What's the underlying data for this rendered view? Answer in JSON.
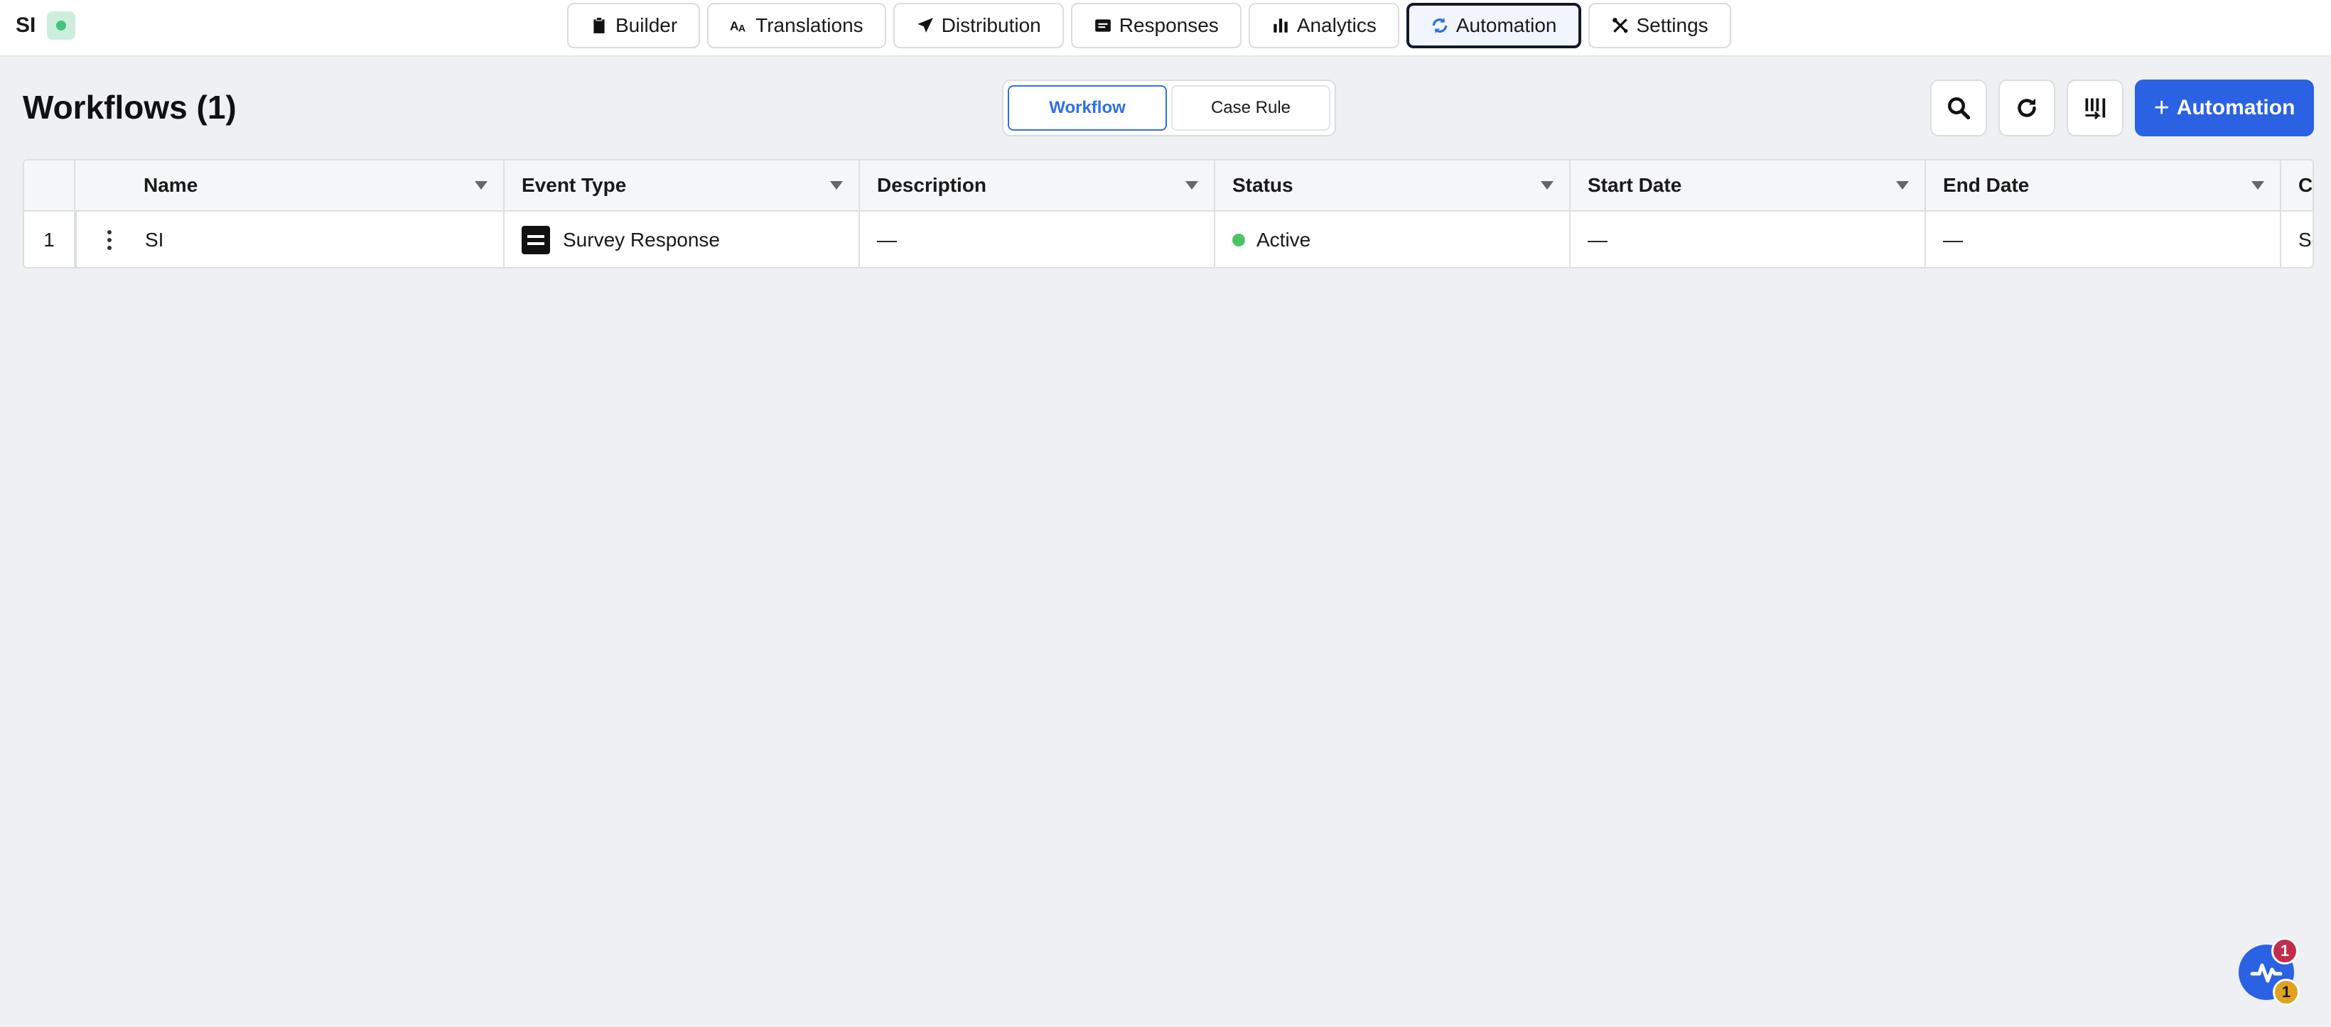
{
  "app": {
    "name": "SI",
    "status_color": "#45c27c"
  },
  "nav": {
    "tabs": [
      {
        "label": "Builder",
        "icon": "clipboard-icon"
      },
      {
        "label": "Translations",
        "icon": "translate-icon"
      },
      {
        "label": "Distribution",
        "icon": "send-icon"
      },
      {
        "label": "Responses",
        "icon": "message-icon"
      },
      {
        "label": "Analytics",
        "icon": "bar-chart-icon"
      },
      {
        "label": "Automation",
        "icon": "sync-icon",
        "active": true
      },
      {
        "label": "Settings",
        "icon": "tools-icon"
      }
    ]
  },
  "page": {
    "title": "Workflows (1)",
    "toggle": {
      "workflow": "Workflow",
      "case_rule": "Case Rule",
      "selected": "Workflow"
    },
    "actions": {
      "search": "search-icon",
      "refresh": "refresh-icon",
      "columns": "column-settings-icon",
      "add_label": "Automation",
      "add_prefix": "+"
    }
  },
  "table": {
    "columns": [
      "Name",
      "Event Type",
      "Description",
      "Status",
      "Start Date",
      "End Date",
      "Crea"
    ],
    "rows": [
      {
        "index": "1",
        "name": "SI",
        "event_type": "Survey Response",
        "description": "—",
        "status": "Active",
        "start_date": "—",
        "end_date": "—",
        "created": "Sep"
      }
    ]
  },
  "widget": {
    "badge_top": "1",
    "badge_bottom": "1",
    "accent": "#2b62e3"
  },
  "colors": {
    "primary": "#2b62e3",
    "active_status": "#4cc463",
    "background": "#eef0f3"
  }
}
